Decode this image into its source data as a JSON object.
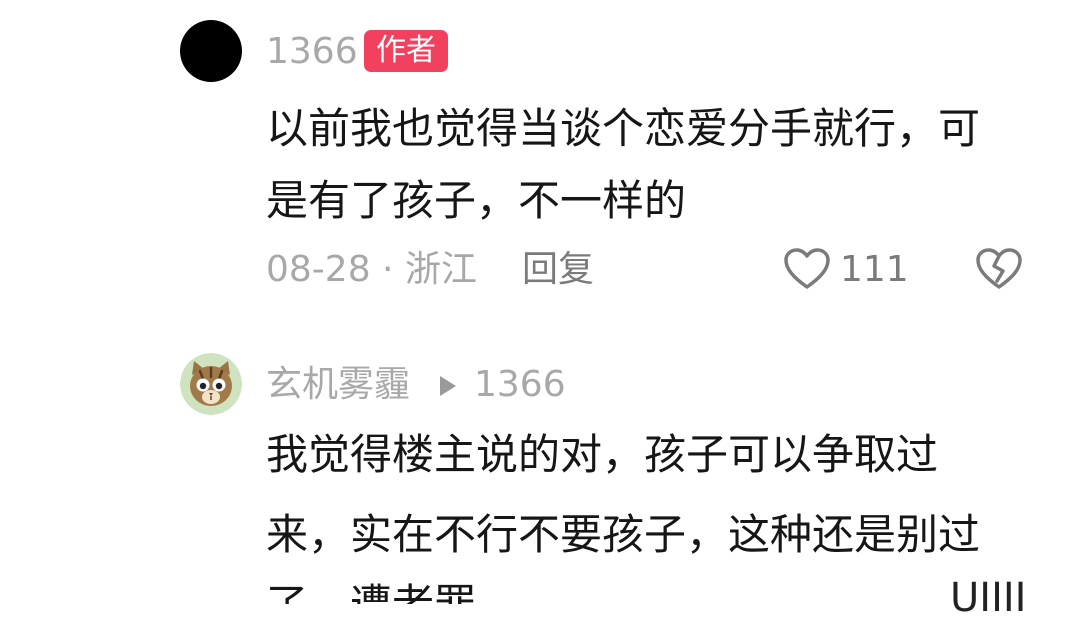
{
  "comment": {
    "username": "1366",
    "author_badge": "作者",
    "text_lines": [
      "以前我也觉得当谈个恋爱分手就行，可",
      "是有了孩子，不一样的"
    ],
    "date_location": "08-28 · 浙江",
    "reply_label": "回复",
    "like_count": "111",
    "like_icon": "heart-outline-icon",
    "dislike_icon": "broken-heart-icon"
  },
  "reply": {
    "username": "玄机雾霾",
    "reply_to": "1366",
    "avatar": "cat-face-avatar",
    "text_lines": [
      "我觉得楼主说的对，孩子可以争取过",
      "来，实在不行不要孩子，这种还是别过",
      "了，遭老罪"
    ]
  },
  "watermark": "UIIII",
  "colors": {
    "badge": "#f2415f",
    "meta": "#a8a8a8",
    "text": "#161616"
  }
}
